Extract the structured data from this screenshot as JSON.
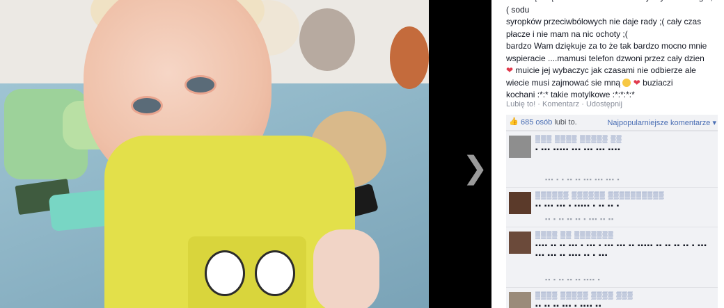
{
  "photo": {
    "description_icons": [
      "child-photo"
    ],
    "next_arrow_glyph": "❯"
  },
  "post": {
    "lines": [
      "zniszczę cząsteczki naskórkiem nie wyszły ... żadnego ;( sodu",
      "syropków przeciwbólowych nie daje rady ;( cały czas",
      "płacze i nie mam na nic ochoty ;(",
      "bardzo Wam dziękuje za to że tak bardzo mocno mnie",
      "wspieracie ....mamusi telefon dzwoni przez cały dzien",
      "muicie jej wybaczyc jak czasami nie odbierze ale",
      "wiecie musi zajmować sie mną",
      "buziaczi",
      "kochani :*:* takie motylkowe :*:*:*:*"
    ]
  },
  "actions": {
    "like": "Lubię to!",
    "sep1": " · ",
    "comment": "Komentarz",
    "sep2": " · ",
    "share": "Udostępnij"
  },
  "likes": {
    "thumb_glyph": "👍",
    "count_text": "685 osób",
    "suffix": "lubi to.",
    "sort_label": "Najpopularniejsze komentarze ▾"
  },
  "comments": [
    {
      "name": "▒▒▒ ▒▒▒▒ ▒▒▒▒▒ ▒▒",
      "text": "▪ ▪▪▪ ▪▪▪▪▪ ▪▪▪ ▪▪▪ ▪▪▪ ▪▪▪▪",
      "meta": "▪▪▪ ▪ ▪ ▪▪ ▪▪ ▪▪▪ ▪▪▪ ▪▪▪ ▪",
      "avatar_color": "#8e8e8e"
    },
    {
      "name": "▒▒▒▒▒▒ ▒▒▒▒▒▒ ▒▒▒▒▒▒▒▒▒▒",
      "text": "▪▪ ▪▪▪ ▪▪▪ ▪ ▪▪▪▪▪ ▪ ▪▪ ▪▪ ▪",
      "meta": "▪▪ ▪ ▪▪ ▪▪ ▪▪ ▪ ▪▪▪ ▪▪ ▪▪",
      "avatar_color": "#5b3a2a"
    },
    {
      "name": "▒▒▒▒ ▒▒ ▒▒▒▒▒▒▒",
      "text": "▪▪▪▪ ▪▪ ▪▪ ▪▪▪ ▪ ▪▪▪ ▪ ▪▪▪ ▪▪▪ ▪▪ ▪▪▪▪▪ ▪▪ ▪▪ ▪▪ ▪▪ ▪ ▪▪▪ ▪▪▪ ▪▪▪ ▪▪ ▪▪▪▪ ▪▪ ▪ ▪▪▪",
      "meta": "▪▪ ▪ ▪▪ ▪▪ ▪▪ ▪▪▪▪ ▪",
      "avatar_color": "#6b4a3a"
    },
    {
      "name": "▒▒▒▒ ▒▒▒▒▒ ▒▒▒▒ ▒▒▒",
      "text": "▪▪ ▪▪ ▪▪ ▪▪▪ ▪ ▪▪▪▪ ▪▪",
      "meta": "",
      "avatar_color": "#9a8b7a"
    }
  ]
}
